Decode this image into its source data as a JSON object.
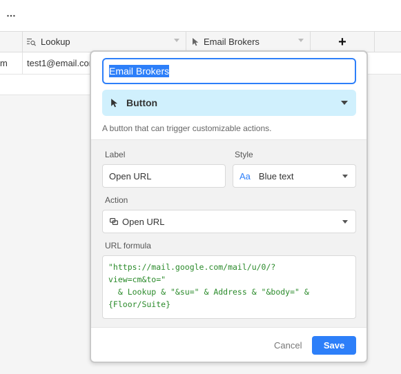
{
  "toolbar": {
    "more_label": "…"
  },
  "grid": {
    "columns": [
      {
        "label": "Lookup",
        "icon": "lookup-icon"
      },
      {
        "label": "Email Brokers",
        "icon": "cursor-icon"
      }
    ],
    "add_field_label": "+",
    "rows": [
      {
        "cell1": "m",
        "lookup": "test1@email.com"
      }
    ]
  },
  "field_config": {
    "name_value": "Email Brokers",
    "type_label": "Button",
    "type_icon": "cursor-icon",
    "description": "A button that can trigger customizable actions.",
    "label_heading": "Label",
    "label_value": "Open URL",
    "style_heading": "Style",
    "style_prefix": "Aa",
    "style_value": "Blue text",
    "action_heading": "Action",
    "action_value": "Open URL",
    "action_icon": "open-url-icon",
    "formula_heading": "URL formula",
    "formula": {
      "line1": "\"https://mail.google.com/mail/u/0/?",
      "line2": "view=cm&to=\"",
      "line3": "  & Lookup & \"&su=\" & Address & \"&body=\" &",
      "line4": "{Floor/Suite}"
    },
    "cancel_label": "Cancel",
    "save_label": "Save"
  },
  "colors": {
    "accent": "#2d7ff9",
    "type_bg": "#d0f0fd",
    "formula_text": "#2a8a2a"
  }
}
